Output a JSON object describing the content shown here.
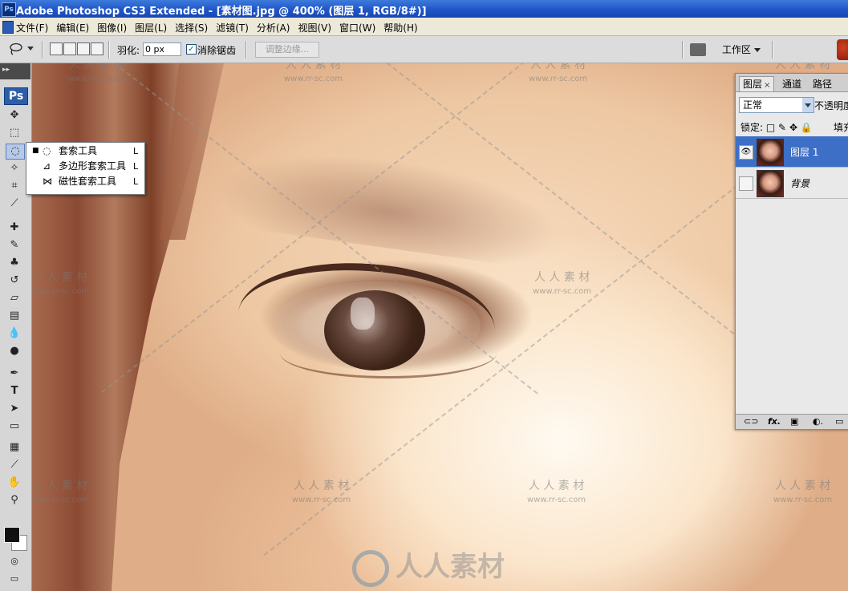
{
  "titlebar": {
    "app_icon": "Ps",
    "title": "Adobe Photoshop CS3 Extended - [素材图.jpg @ 400% (图层 1, RGB/8#)]"
  },
  "menubar": {
    "items": [
      "文件(F)",
      "编辑(E)",
      "图像(I)",
      "图层(L)",
      "选择(S)",
      "滤镜(T)",
      "分析(A)",
      "视图(V)",
      "窗口(W)",
      "帮助(H)"
    ]
  },
  "options": {
    "tool_icon": "lasso-icon",
    "feather_label": "羽化:",
    "feather_value": "0 px",
    "antialias_label": "消除锯齿",
    "antialias_checked": true,
    "refine_edge_label": "调整边缘...",
    "workspace_label": "工作区"
  },
  "toolbox": {
    "badge": "Ps",
    "tools": [
      {
        "name": "move-tool",
        "glyph": "✥"
      },
      {
        "name": "marquee-tool",
        "glyph": "⬚"
      },
      {
        "name": "lasso-tool",
        "glyph": "◌"
      },
      {
        "name": "magic-wand-tool",
        "glyph": "✧"
      },
      {
        "name": "crop-tool",
        "glyph": "⌗"
      },
      {
        "name": "slice-tool",
        "glyph": "⟋"
      },
      {
        "name": "healing-brush-tool",
        "glyph": "✚"
      },
      {
        "name": "brush-tool",
        "glyph": "✎"
      },
      {
        "name": "clone-stamp-tool",
        "glyph": "♣"
      },
      {
        "name": "history-brush-tool",
        "glyph": "↺"
      },
      {
        "name": "eraser-tool",
        "glyph": "▱"
      },
      {
        "name": "gradient-tool",
        "glyph": "▤"
      },
      {
        "name": "blur-tool",
        "glyph": "💧"
      },
      {
        "name": "dodge-tool",
        "glyph": "●"
      },
      {
        "name": "pen-tool",
        "glyph": "✒"
      },
      {
        "name": "type-tool",
        "glyph": "T"
      },
      {
        "name": "path-selection-tool",
        "glyph": "➤"
      },
      {
        "name": "shape-tool",
        "glyph": "▭"
      },
      {
        "name": "notes-tool",
        "glyph": "▦"
      },
      {
        "name": "eyedropper-tool",
        "glyph": "⟋"
      },
      {
        "name": "hand-tool",
        "glyph": "✋"
      },
      {
        "name": "zoom-tool",
        "glyph": "⚲"
      }
    ]
  },
  "flyout": {
    "items": [
      {
        "label": "套索工具",
        "shortcut": "L",
        "selected": true,
        "icon": "lasso-icon"
      },
      {
        "label": "多边形套索工具",
        "shortcut": "L",
        "selected": false,
        "icon": "polygonal-lasso-icon"
      },
      {
        "label": "磁性套索工具",
        "shortcut": "L",
        "selected": false,
        "icon": "magnetic-lasso-icon"
      }
    ]
  },
  "layers_panel": {
    "tabs": [
      "图层",
      "通道",
      "路径"
    ],
    "active_tab": "图层",
    "blend_mode": "正常",
    "opacity_label": "不透明度",
    "lock_label": "锁定:",
    "fill_label": "填充",
    "layers": [
      {
        "name": "图层 1",
        "visible": true,
        "selected": true
      },
      {
        "name": "背景",
        "visible": false,
        "selected": false
      }
    ],
    "footer_icons": [
      "link-icon",
      "fx-icon",
      "mask-icon",
      "adjustment-icon",
      "new-layer-icon"
    ],
    "footer_fx": "fx."
  },
  "watermarks": {
    "cn": "人人素材",
    "cn_spaced": "人 人 素 材",
    "url": "www.rr-sc.com",
    "big": "人人素材"
  }
}
